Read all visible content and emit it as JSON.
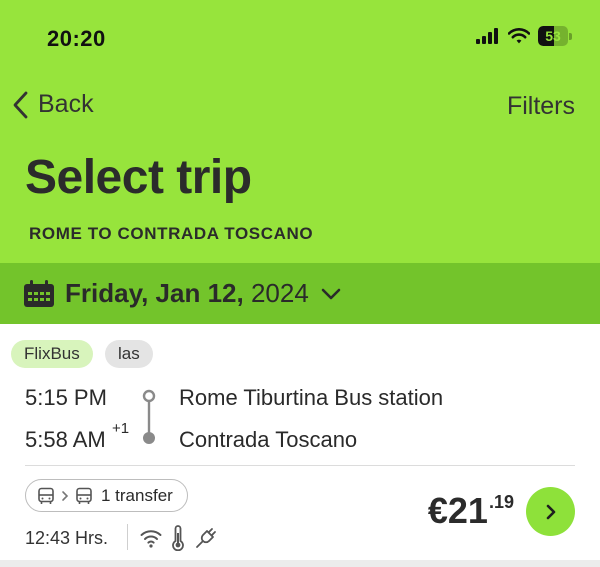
{
  "status_bar": {
    "time": "20:20",
    "battery": "53",
    "battery_level": 0.53,
    "icons": [
      "signal-icon",
      "wifi-icon",
      "battery-icon"
    ]
  },
  "nav": {
    "back_label": "Back",
    "filters_label": "Filters"
  },
  "page": {
    "title": "Select trip",
    "route": "ROME TO CONTRADA TOSCANO"
  },
  "date_bar": {
    "date_main": "Friday, Jan 12,",
    "year": " 2024",
    "icons": [
      "calendar-icon",
      "chevron-down-icon"
    ]
  },
  "trip": {
    "tags": [
      "FlixBus",
      "las"
    ],
    "departure_time": "5:15 PM",
    "arrival_time": "5:58 AM",
    "arrival_day_offset": "+1",
    "departure_station": "Rome Tiburtina Bus station",
    "arrival_station": "Contrada Toscano",
    "transfer_label": "1 transfer",
    "duration": "12:43 Hrs.",
    "amenities": [
      "wifi-icon",
      "thermometer-icon",
      "power-plug-icon"
    ],
    "price_main": "€21",
    "price_cents": ".19"
  },
  "colors": {
    "header_green": "#97e43c",
    "date_bar_green": "#73c42b",
    "tag_green": "#d8f4bc",
    "button_green": "#8ee13a"
  }
}
